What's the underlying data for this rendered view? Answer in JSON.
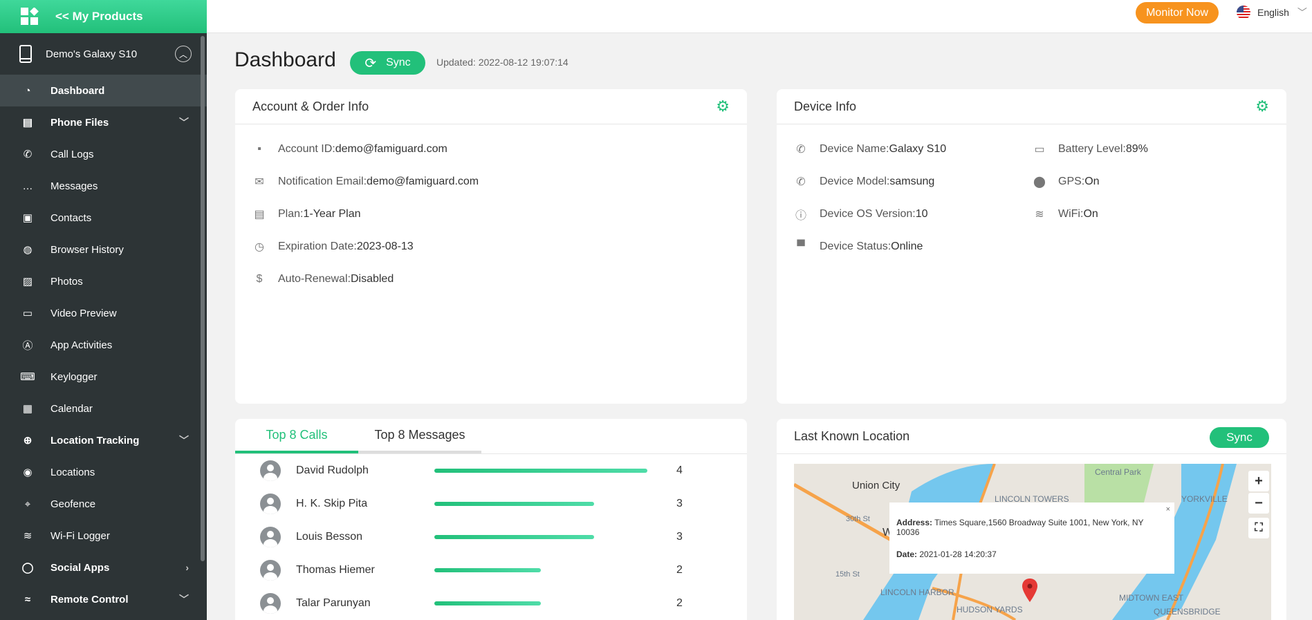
{
  "sidebar": {
    "brand": "<< My Products",
    "device": "Demo's Galaxy S10",
    "items": [
      {
        "label": "Dashboard",
        "icon": "gauge-icon",
        "active": true,
        "bold": true
      },
      {
        "label": "Phone Files",
        "icon": "file-icon",
        "bold": true,
        "chevron": "down"
      },
      {
        "label": "Call Logs",
        "icon": "phone-icon"
      },
      {
        "label": "Messages",
        "icon": "chat-icon"
      },
      {
        "label": "Contacts",
        "icon": "contact-icon"
      },
      {
        "label": "Browser History",
        "icon": "globe-icon"
      },
      {
        "label": "Photos",
        "icon": "image-icon"
      },
      {
        "label": "Video Preview",
        "icon": "video-icon"
      },
      {
        "label": "App Activities",
        "icon": "app-store-icon"
      },
      {
        "label": "Keylogger",
        "icon": "keyboard-icon"
      },
      {
        "label": "Calendar",
        "icon": "calendar-icon"
      },
      {
        "label": "Location Tracking",
        "icon": "crosshair-icon",
        "bold": true,
        "chevron": "down"
      },
      {
        "label": "Locations",
        "icon": "pin-icon"
      },
      {
        "label": "Geofence",
        "icon": "geofence-icon"
      },
      {
        "label": "Wi-Fi Logger",
        "icon": "wifi-icon"
      },
      {
        "label": "Social Apps",
        "icon": "bubble-icon",
        "bold": true,
        "chevron": "right"
      },
      {
        "label": "Remote Control",
        "icon": "remote-icon",
        "bold": true,
        "chevron": "down"
      }
    ]
  },
  "topbar": {
    "monitor": "Monitor Now",
    "language": "English"
  },
  "main": {
    "title": "Dashboard",
    "sync": "Sync",
    "updated": "Updated: 2022-08-12 19:07:14"
  },
  "account": {
    "title": "Account & Order Info",
    "rows": [
      {
        "icon": "user-icon",
        "label": "Account ID: ",
        "value": "demo@famiguard.com"
      },
      {
        "icon": "mail-icon",
        "label": "Notification Email: ",
        "value": "demo@famiguard.com"
      },
      {
        "icon": "document-icon",
        "label": "Plan: ",
        "value": "1-Year Plan"
      },
      {
        "icon": "clock-icon",
        "label": "Expiration Date: ",
        "value": "2023-08-13"
      },
      {
        "icon": "dollar-icon",
        "label": "Auto-Renewal: ",
        "value": "Disabled"
      }
    ]
  },
  "device": {
    "title": "Device Info",
    "left": [
      {
        "icon": "phone-icon",
        "label": "Device Name:",
        "value": "Galaxy S10"
      },
      {
        "icon": "phone-icon",
        "label": "Device Model: ",
        "value": "samsung"
      },
      {
        "icon": "info-icon",
        "label": "Device OS Version: ",
        "value": "10"
      },
      {
        "icon": "monitor-icon",
        "label": "Device Status:",
        "value": "Online"
      }
    ],
    "right": [
      {
        "icon": "battery-icon",
        "label": "Battery Level: ",
        "value": "89%"
      },
      {
        "icon": "location-icon",
        "label": "GPS:",
        "value": "On"
      },
      {
        "icon": "wifi-icon",
        "label": "WiFi:",
        "value": "On"
      }
    ]
  },
  "top": {
    "tabs": [
      "Top 8 Calls",
      "Top 8 Messages"
    ],
    "max": 4,
    "calls": [
      {
        "name": "David Rudolph",
        "count": 4
      },
      {
        "name": "H. K. Skip Pita",
        "count": 3
      },
      {
        "name": "Louis Besson",
        "count": 3
      },
      {
        "name": "Thomas Hiemer",
        "count": 2
      },
      {
        "name": "Talar Parunyan",
        "count": 2
      }
    ]
  },
  "location": {
    "title": "Last Known Location",
    "sync": "Sync",
    "address_label": "Address:",
    "address": " Times Square,1560 Broadway Suite 1001, New York, NY 10036",
    "date_label": "Date:",
    "date": " 2021-01-28 14:20:37",
    "map_labels": [
      "Union City",
      "Central Park",
      "LINCOLN TOWERS",
      "YORKVILLE",
      "Weeh",
      "LINCOLN HARBOR",
      "HUDSON YARDS",
      "MIDTOWN EAST",
      "QUEENSBRIDGE",
      "30th St",
      "15th St"
    ]
  }
}
